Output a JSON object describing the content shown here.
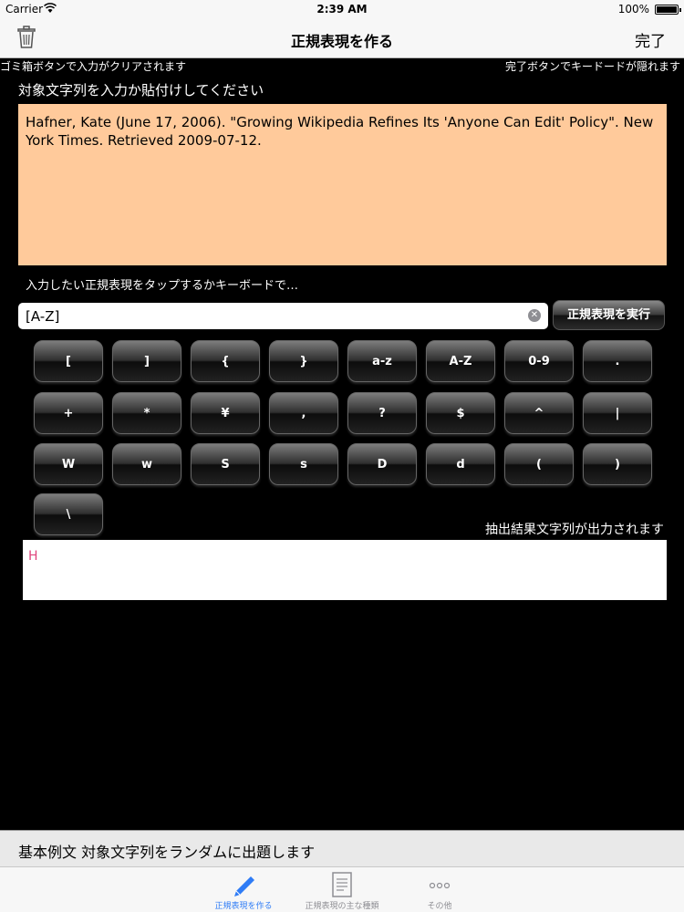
{
  "status_bar": {
    "carrier": "Carrier",
    "time": "2:39 AM",
    "battery": "100%"
  },
  "nav": {
    "title": "正規表現を作る",
    "done_label": "完了"
  },
  "hints": {
    "left": "ゴミ箱ボタンで入力がクリアされます",
    "right": "完了ボタンでキードードが隠れます"
  },
  "target": {
    "label": "対象文字列を入力か貼付けしてください",
    "text": "Hafner, Kate (June 17, 2006). \"Growing Wikipedia Refines Its 'Anyone Can Edit' Policy\". New York Times. Retrieved 2009-07-12."
  },
  "regex": {
    "label": "入力したい正規表現をタップするかキーボードで…",
    "value": "[A-Z]",
    "execute_label": "正規表現を実行"
  },
  "keys": [
    "[",
    "]",
    "{",
    "}",
    "a-z",
    "A-Z",
    "0-9",
    ".",
    "+",
    "*",
    "¥",
    ",",
    "?",
    "$",
    "^",
    "|",
    "W",
    "w",
    "S",
    "s",
    "D",
    "d",
    "(",
    ")",
    "\\"
  ],
  "result": {
    "label": "抽出結果文字列が出力されます",
    "value": "H"
  },
  "footer": {
    "text": "基本例文  対象文字列をランダムに出題します"
  },
  "tabs": [
    {
      "label": "正規表現を作る",
      "icon": "pencil-icon",
      "active": true
    },
    {
      "label": "正規表現の主な種類",
      "icon": "document-icon",
      "active": false
    },
    {
      "label": "その他",
      "icon": "more-icon",
      "active": false
    }
  ],
  "colors": {
    "target_bg": "#ffca9b",
    "result_text": "#e0447c",
    "tab_active": "#2f7cf6"
  }
}
